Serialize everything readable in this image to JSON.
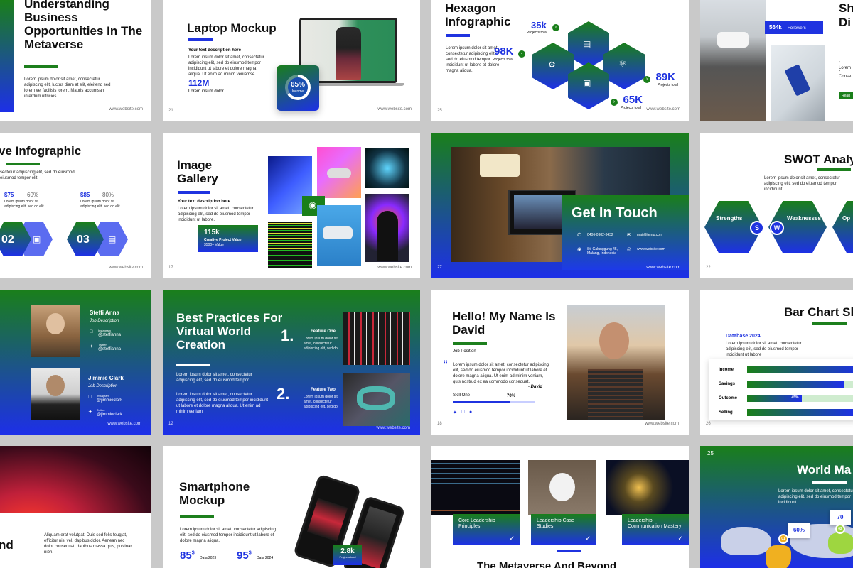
{
  "s1": {
    "title": "Understanding Business Opportunities In The Metaverse",
    "body": "Lorem ipsum dolor sit amet, consectetur adipiscing elit, luctus diam at elit, eleifend sed lorem vel facilisis lorem. Mauris accumsan interdum ultricies.",
    "web": "www.website.com"
  },
  "s2": {
    "title": "Laptop Mockup",
    "sub": "Your text description here",
    "body": "Lorem ipsum dolor sit amet, consectetur adipiscing elit, sed do eiusmod tempor incididunt ut labore et dolore magna aliqua. Ut enim ad minim veniamse",
    "stat": "112M",
    "stat_label": "Lorem ipsum dolor",
    "ring": "65%",
    "ring_label": "Income",
    "num": "21",
    "web": "www.website.com"
  },
  "s3": {
    "title": "Hexagon Infographic",
    "body": "Lorem ipsum dolor sit amet, consectetur adipiscing elit, sed do eiusmod tempor incididunt ut labore et dolore magna aliqua.",
    "v1": "35k",
    "v2": "98K",
    "v3": "89K",
    "v4": "65K",
    "cap": "Projects total",
    "num": "25",
    "web": "www.website.com"
  },
  "s4": {
    "followers_num": "564k",
    "followers": "Followers",
    "l1": "Lorem",
    "l2": "Conse",
    "title": "Sh Di",
    "btn": "Read"
  },
  "s5": {
    "title": "ve Infographic",
    "body": "sectetur adipiscing elit, sed do eiusmod eiusmod tempor elit",
    "p1": "$75",
    "q1": "60%",
    "p2": "$85",
    "q2": "80%",
    "sm": "Lorem ipsum dolor sit adipiscing elit, sed do elit",
    "n1": "02",
    "n2": "03",
    "web": "www.website.com"
  },
  "s6": {
    "title": "Image Gallery",
    "sub": "Your text description here",
    "body": "Lorem ipsum dolor sit amet, consectetur adipiscing elit, sed do eiusmod tempor incididunt ut labore.",
    "stat": "115k",
    "stat_label": "Creative Project Value",
    "stat_sub": "3500+ Value",
    "num": "17",
    "web": "www.website.com"
  },
  "s7": {
    "title": "Get In Touch",
    "phone": "0406-0982-3432",
    "mail": "mail@temp.com",
    "addr": "St. Galunggung 45, Malang, Indonesia",
    "site": "www.website.com",
    "num": "27",
    "web": "www.website.com"
  },
  "s8": {
    "title": "SWOT Analy",
    "body": "Lorem ipsum dolor sit amet, consectetur adipiscing elit, sed do eiusmod tempor incididunt",
    "h1": "Strengths",
    "h2": "Weaknesses",
    "h3": "Op",
    "l1": "S",
    "l2": "W",
    "num": "22"
  },
  "s9": {
    "n1": "Steffi Anna",
    "d1": "Job Description",
    "ig": "Instagram",
    "tw": "Twitter",
    "h1": "@steffianna",
    "n2": "Jimmie Clark",
    "d2": "Job Description",
    "h2": "@jimmieclark",
    "web": "www.website.com"
  },
  "s10": {
    "title": "Best Practices For Virtual World Creation",
    "body1": "Lorem ipsum dolor sit amet, consectetur adipiscing elit, sed do eiusmod tempor.",
    "body2": "Lorem ipsum dolor sit amet, consectetur adipiscing elit, sed do eiusmod tempor incididunt ut labore et dolore magna aliqua. Ut enim ad minim veniam",
    "n1": "1.",
    "f1": "Feature One",
    "fb1": "Lorem ipsum dolor sit amet, consectetur adipiscing elit, sed do",
    "n2": "2.",
    "f2": "Feature Two",
    "fb2": "Lorem ipsum dolor sit amet, consectetur adipiscing elit, sed do",
    "num": "12",
    "web": "www.website.com"
  },
  "s11": {
    "title": "Hello! My Name Is David",
    "pos": "Job Position",
    "quote": "Lorem ipsum dolor sit amet, consectetur adipiscing elit, sed do eiusmod tempor incididunt ut labore et dolore magna aliqua. Ut enim ad minim veniam, quis nostrud ex ea commodo consequat.",
    "author": "- David",
    "skill": "Skill One",
    "pct": "70%",
    "skill_level": 0.7,
    "num": "18",
    "web": "www.website.com"
  },
  "s12": {
    "title": "Bar Chart Sl",
    "db": "Database 2024",
    "body": "Lorem ipsum dolor sit amet, consectetur adipiscing elit, sed do eiusmod tempor incididunt ut labore",
    "rows": [
      {
        "label": "Income",
        "value": 0.95
      },
      {
        "label": "Savings",
        "value": 0.8
      },
      {
        "label": "Outcome",
        "value": 0.45,
        "tag": "45%"
      },
      {
        "label": "Selling",
        "value": 0.9
      }
    ],
    "num": "26"
  },
  "s13": {
    "title": "nd",
    "body": "Aliquam erat volutpat. Duis sed felis feugiat, efficitur nisi vel, dapibus dolor. Aenean nec dolor consequat, dapibus massa quis, pulvinar nibh."
  },
  "s14": {
    "title": "Smartphone Mockup",
    "body": "Lorem ipsum dolor sit amet, consectetur adipiscing elit, sed do eiusmod tempor incididunt ut labore et dolore magna aliqua.",
    "v1": "85",
    "v2": "95",
    "cur": "$",
    "d1": "Data 2023",
    "d2": "Data 2024",
    "badge": "2.8k",
    "badge_label": "Projects total"
  },
  "s15": {
    "c1": "Core Leadership Principles",
    "c2": "Leadership Case Studies",
    "c3": "Leadership Communication Mastery",
    "title": "The Metaverse And Beyond"
  },
  "s16": {
    "num": "25",
    "title": "World Ma",
    "body": "Lorem ipsum dolor sit amet, consectetur adipiscing elit, sed do eiusmod tempor incididunt",
    "pct1": "60%",
    "pct2": "70",
    "m1": "01",
    "m2": "02"
  }
}
